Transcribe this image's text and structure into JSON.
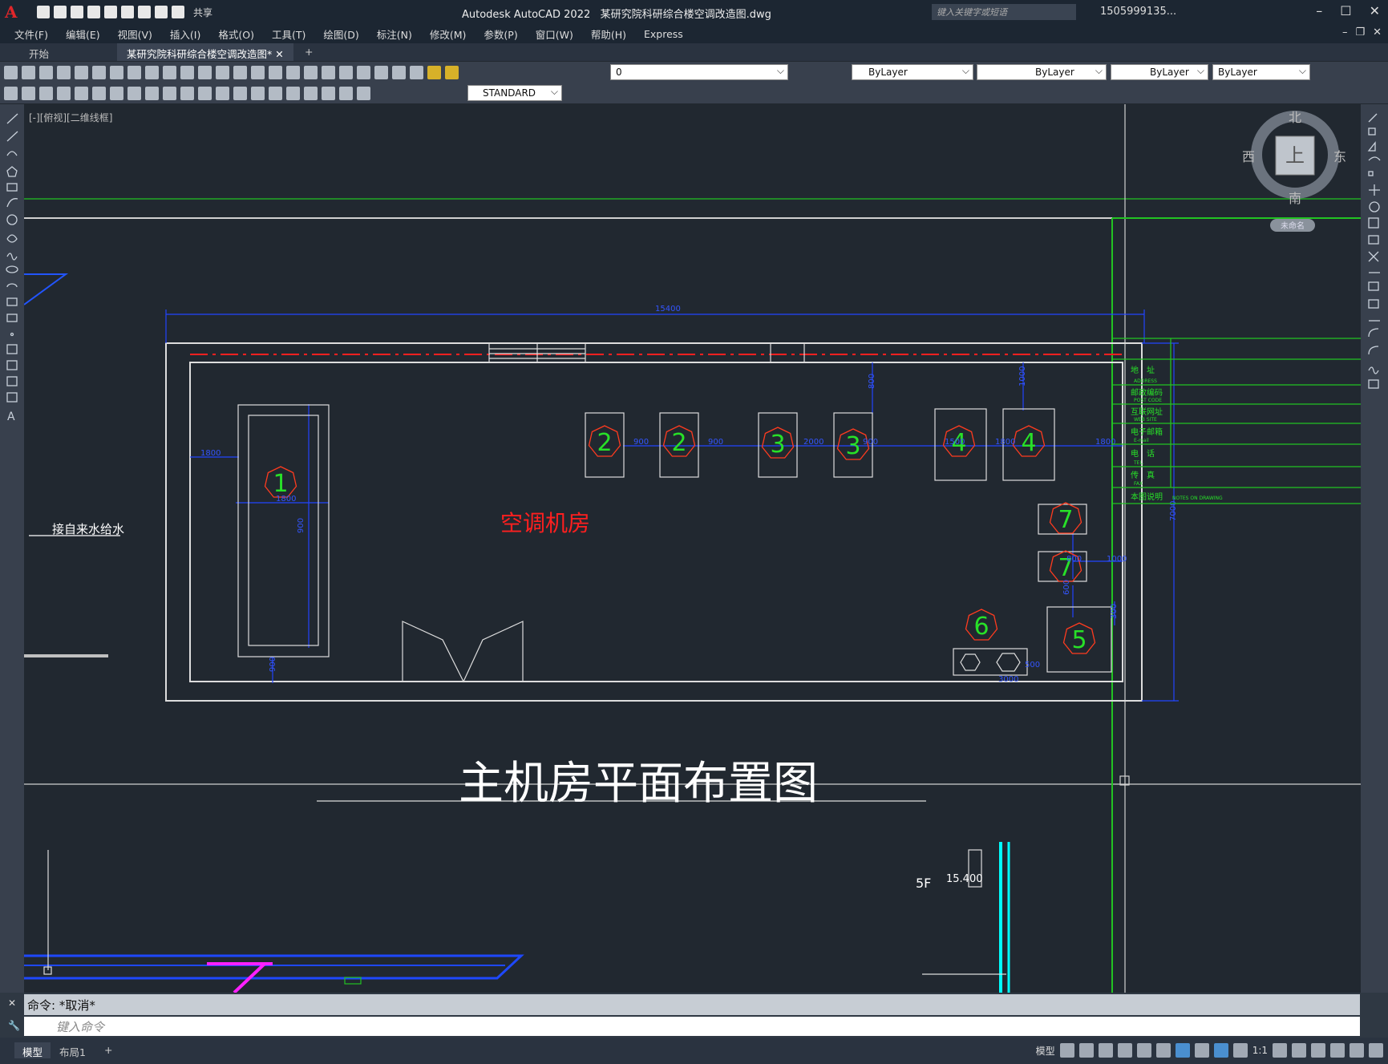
{
  "app": {
    "title": "Autodesk AutoCAD 2022",
    "document": "某研究院科研综合楼空调改造图.dwg",
    "search_placeholder": "键入关键字或短语",
    "user": "1505999135...",
    "share": "共享"
  },
  "menus": [
    "文件(F)",
    "编辑(E)",
    "视图(V)",
    "插入(I)",
    "格式(O)",
    "工具(T)",
    "绘图(D)",
    "标注(N)",
    "修改(M)",
    "参数(P)",
    "窗口(W)",
    "帮助(H)",
    "Express"
  ],
  "tabs": {
    "start": "开始",
    "active": "某研究院科研综合楼空调改造图*",
    "add": "+"
  },
  "toolbar": {
    "layer": "0",
    "color": "ByLayer",
    "linetype": "ByLayer",
    "lineweight": "ByLayer",
    "plotstyle": "ByLayer",
    "textstyle": "STANDARD"
  },
  "viewcube": {
    "north": "北",
    "south": "南",
    "east": "东",
    "west": "西",
    "face": "上",
    "wcs": "未命名"
  },
  "viewport_label": "[-][俯视][二维线框]",
  "drawing": {
    "room_label": "空调机房",
    "plan_title": "主机房平面布置图",
    "supply_label": "接自来水给水",
    "floor_label": "5F",
    "elevation": "15.400",
    "dims": [
      "15400",
      "1800",
      "1800",
      "900",
      "900",
      "900",
      "900",
      "2000",
      "900",
      "1500",
      "1800",
      "1800",
      "800",
      "1000",
      "800",
      "1000",
      "600",
      "300",
      "500",
      "3000",
      "7000"
    ],
    "markers": [
      "1",
      "2",
      "2",
      "3",
      "3",
      "4",
      "4",
      "7",
      "7",
      "6",
      "5"
    ]
  },
  "titleblock": {
    "rows": [
      {
        "cn": "地　址",
        "en": "ADDRESS"
      },
      {
        "cn": "邮政编码",
        "en": "POST CODE"
      },
      {
        "cn": "互联网址",
        "en": "WEB SITE"
      },
      {
        "cn": "电子邮箱",
        "en": "E-mail"
      },
      {
        "cn": "电　话",
        "en": "TEL."
      },
      {
        "cn": "传　真",
        "en": "FAX"
      }
    ],
    "notes_cn": "本图说明",
    "notes_en": "NOTES ON DRAWING"
  },
  "command": {
    "history": "命令: *取消*",
    "placeholder": "键入命令"
  },
  "statusbar": {
    "model": "模型",
    "layout": "布局1",
    "add": "+",
    "model_btn": "模型",
    "scale": "1:1"
  }
}
